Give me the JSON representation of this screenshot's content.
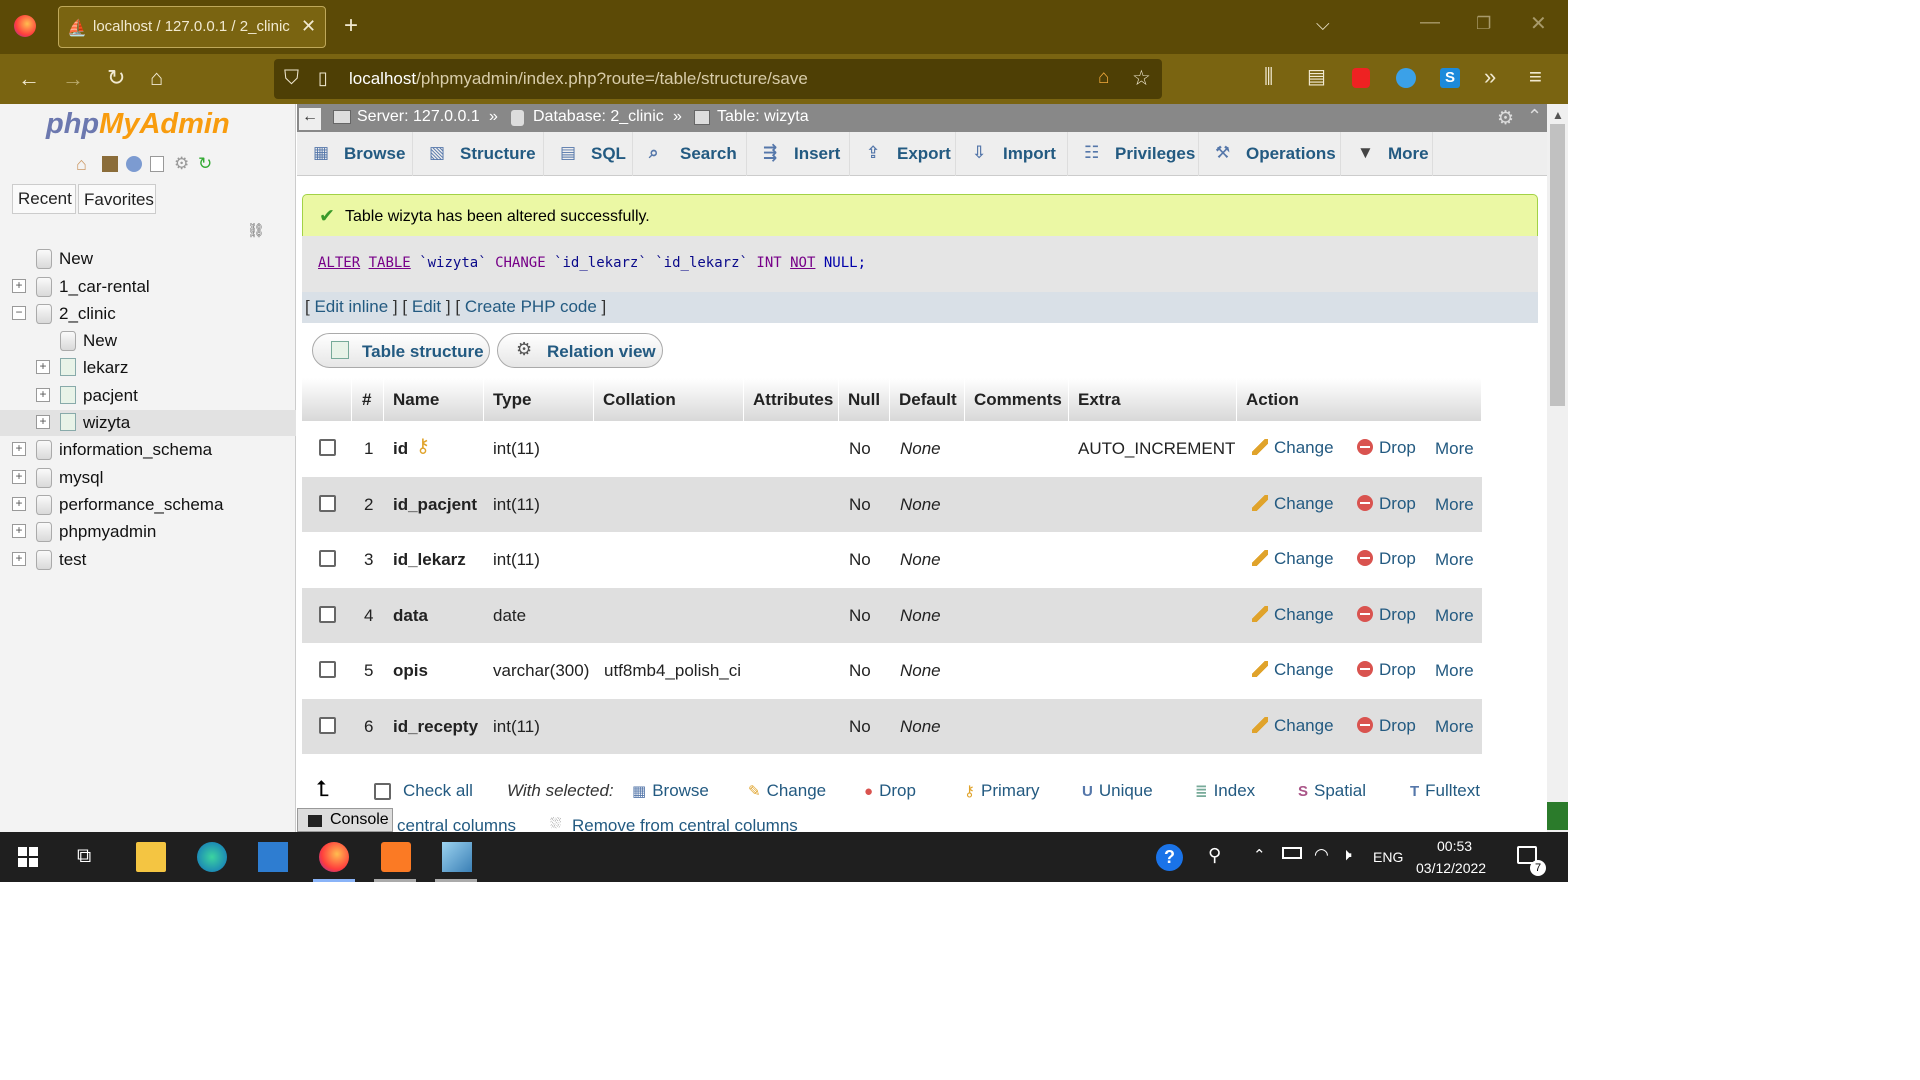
{
  "browser": {
    "tab_title": "localhost / 127.0.0.1 / 2_clinic / ",
    "url_host": "localhost",
    "url_path": "/phpmyadmin/index.php?route=/table/structure/save",
    "new_tab": "+"
  },
  "sidebar": {
    "logo_php": "php",
    "logo_myadmin": "MyAdmin",
    "recent": "Recent",
    "favorites": "Favorites",
    "tree": [
      {
        "label": "New",
        "level": 0
      },
      {
        "label": "1_car-rental",
        "level": 0
      },
      {
        "label": "2_clinic",
        "level": 0
      },
      {
        "label": "New",
        "level": 1
      },
      {
        "label": "lekarz",
        "level": 1
      },
      {
        "label": "pacjent",
        "level": 1
      },
      {
        "label": "wizyta",
        "level": 1
      },
      {
        "label": "information_schema",
        "level": 0
      },
      {
        "label": "mysql",
        "level": 0
      },
      {
        "label": "performance_schema",
        "level": 0
      },
      {
        "label": "phpmyadmin",
        "level": 0
      },
      {
        "label": "test",
        "level": 0
      }
    ]
  },
  "breadcrumb": {
    "server": "Server: 127.0.0.1",
    "database": "Database: 2_clinic",
    "table": "Table: wizyta",
    "sep": "»"
  },
  "tabs": [
    "Browse",
    "Structure",
    "SQL",
    "Search",
    "Insert",
    "Export",
    "Import",
    "Privileges",
    "Operations",
    "More"
  ],
  "message": {
    "success": "Table wizyta has been altered successfully.",
    "sql": {
      "alter": "ALTER",
      "table": "TABLE",
      "tname": "`wizyta`",
      "change": "CHANGE",
      "col1": "`id_lekarz`",
      "col2": "`id_lekarz`",
      "int": "INT",
      "not": "NOT",
      "null": "NULL;"
    },
    "links": {
      "edit_inline": "Edit inline",
      "edit": "Edit",
      "create_php": "Create PHP code",
      "lb": "[",
      "rb": "]"
    }
  },
  "subtabs": {
    "table_structure": "Table structure",
    "relation_view": "Relation view"
  },
  "table": {
    "headers": [
      "#",
      "Name",
      "Type",
      "Collation",
      "Attributes",
      "Null",
      "Default",
      "Comments",
      "Extra",
      "Action"
    ],
    "rows": [
      {
        "num": "1",
        "name": "id",
        "type": "int(11)",
        "collation": "",
        "null": "No",
        "default": "None",
        "extra": "AUTO_INCREMENT",
        "key": true
      },
      {
        "num": "2",
        "name": "id_pacjent",
        "type": "int(11)",
        "collation": "",
        "null": "No",
        "default": "None",
        "extra": "",
        "key": false
      },
      {
        "num": "3",
        "name": "id_lekarz",
        "type": "int(11)",
        "collation": "",
        "null": "No",
        "default": "None",
        "extra": "",
        "key": false
      },
      {
        "num": "4",
        "name": "data",
        "type": "date",
        "collation": "",
        "null": "No",
        "default": "None",
        "extra": "",
        "key": false
      },
      {
        "num": "5",
        "name": "opis",
        "type": "varchar(300)",
        "collation": "utf8mb4_polish_ci",
        "null": "No",
        "default": "None",
        "extra": "",
        "key": false
      },
      {
        "num": "6",
        "name": "id_recepty",
        "type": "int(11)",
        "collation": "",
        "null": "No",
        "default": "None",
        "extra": "",
        "key": false
      }
    ],
    "actions": {
      "change": "Change",
      "drop": "Drop",
      "more": "More"
    }
  },
  "bulk": {
    "check_all": "Check all",
    "with_selected": "With selected:",
    "items": [
      "Browse",
      "Change",
      "Drop",
      "Primary",
      "Unique",
      "Index",
      "Spatial",
      "Fulltext"
    ],
    "central": "central columns",
    "remove_central": "Remove from central columns"
  },
  "console": "Console",
  "taskbar": {
    "time": "00:53",
    "date": "03/12/2022",
    "lang": "ENG",
    "notif": "7"
  }
}
